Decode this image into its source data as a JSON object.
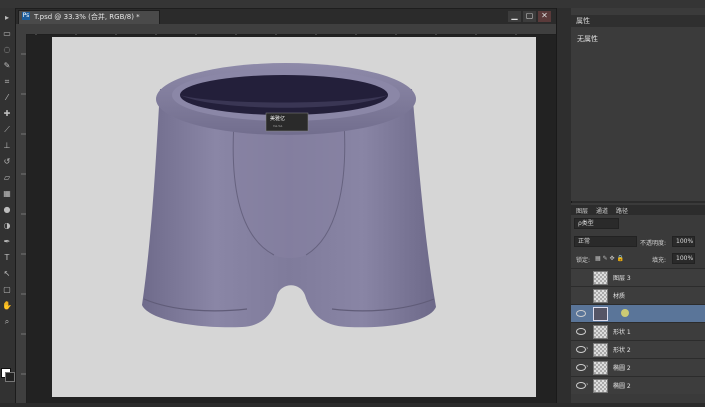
{
  "document": {
    "tab_label": "T.psd @ 33.3% (合并, RGB/8) *",
    "app_icon": "ps-icon",
    "product_label_top": "美雅亿",
    "product_label_bottom": "Y.A.Y.A"
  },
  "window_controls": [
    "minimize-icon",
    "restore-icon",
    "close-icon"
  ],
  "properties_panel": {
    "title": "属性",
    "empty_text": "无属性"
  },
  "layers_panel": {
    "tabs": [
      "图层",
      "通道",
      "路径"
    ],
    "filter_label": "ρ类型",
    "blend_mode": "正常",
    "opacity_label": "不透明度:",
    "opacity_value": "100%",
    "lock_label": "锁定:",
    "fill_label": "填充:",
    "fill_value": "100%",
    "layers": [
      {
        "name": "图层 3",
        "visible": false,
        "selected": false
      },
      {
        "name": "材质",
        "visible": false,
        "selected": false
      },
      {
        "name": "",
        "visible": true,
        "selected": true
      },
      {
        "name": "形状 1",
        "visible": true,
        "selected": false
      },
      {
        "name": "形状 2",
        "visible": true,
        "selected": false
      },
      {
        "name": "椭圆 2",
        "visible": true,
        "selected": false
      },
      {
        "name": "椭圆 2",
        "visible": true,
        "selected": false
      }
    ]
  },
  "colors": {
    "garment": "#7e7a9a",
    "canvas_bg": "#d6d6d6",
    "selection": "#5a7599"
  },
  "toolbar_icons": [
    "move-icon",
    "marquee-icon",
    "lasso-icon",
    "quick-select-icon",
    "crop-icon",
    "eyedropper-icon",
    "healing-icon",
    "brush-icon",
    "stamp-icon",
    "history-brush-icon",
    "eraser-icon",
    "gradient-icon",
    "blur-icon",
    "dodge-icon",
    "pen-icon",
    "type-icon",
    "path-select-icon",
    "shape-icon",
    "hand-icon",
    "zoom-icon"
  ]
}
